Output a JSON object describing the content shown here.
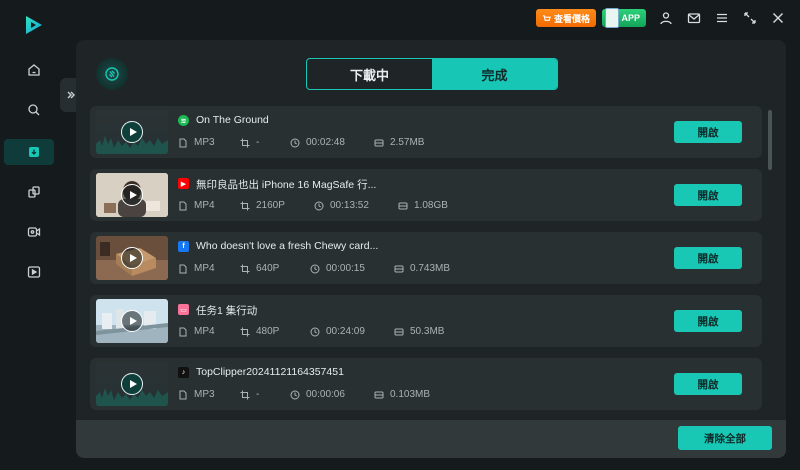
{
  "topbar": {
    "promo_label": "查看價格",
    "app_label": "APP"
  },
  "tabs": [
    {
      "label": "下載中",
      "active": false
    },
    {
      "label": "完成",
      "active": true
    }
  ],
  "items": [
    {
      "source": "spotify-icon",
      "source_color": "#1DB954",
      "title": "On The Ground",
      "thumb": "audio",
      "format": "MP3",
      "resolution": "-",
      "duration": "00:02:48",
      "size": "2.57MB",
      "open_label": "開啟"
    },
    {
      "source": "youtube-icon",
      "source_color": "#FF0000",
      "title": "無印良品也出 iPhone 16 MagSafe 行...",
      "thumb": "video-person",
      "format": "MP4",
      "resolution": "2160P",
      "duration": "00:13:52",
      "size": "1.08GB",
      "open_label": "開啟"
    },
    {
      "source": "facebook-icon",
      "source_color": "#1877F2",
      "title": "Who doesn't love a fresh Chewy card...",
      "thumb": "video-box",
      "format": "MP4",
      "resolution": "640P",
      "duration": "00:00:15",
      "size": "0.743MB",
      "open_label": "開啟"
    },
    {
      "source": "bilibili-icon",
      "source_color": "#FB7299",
      "title": "任务1 集行动",
      "thumb": "video-city",
      "format": "MP4",
      "resolution": "480P",
      "duration": "00:24:09",
      "size": "50.3MB",
      "open_label": "開啟"
    },
    {
      "source": "tiktok-icon",
      "source_color": "#111111",
      "title": "TopClipper20241121164357451",
      "thumb": "audio",
      "format": "MP3",
      "resolution": "-",
      "duration": "00:00:06",
      "size": "0.103MB",
      "open_label": "開啟"
    }
  ],
  "footer": {
    "clear_all_label": "清除全部"
  },
  "colors": {
    "accent": "#19C7B5",
    "background": "#151A1C",
    "panel": "#1F2527",
    "row": "#283032"
  }
}
